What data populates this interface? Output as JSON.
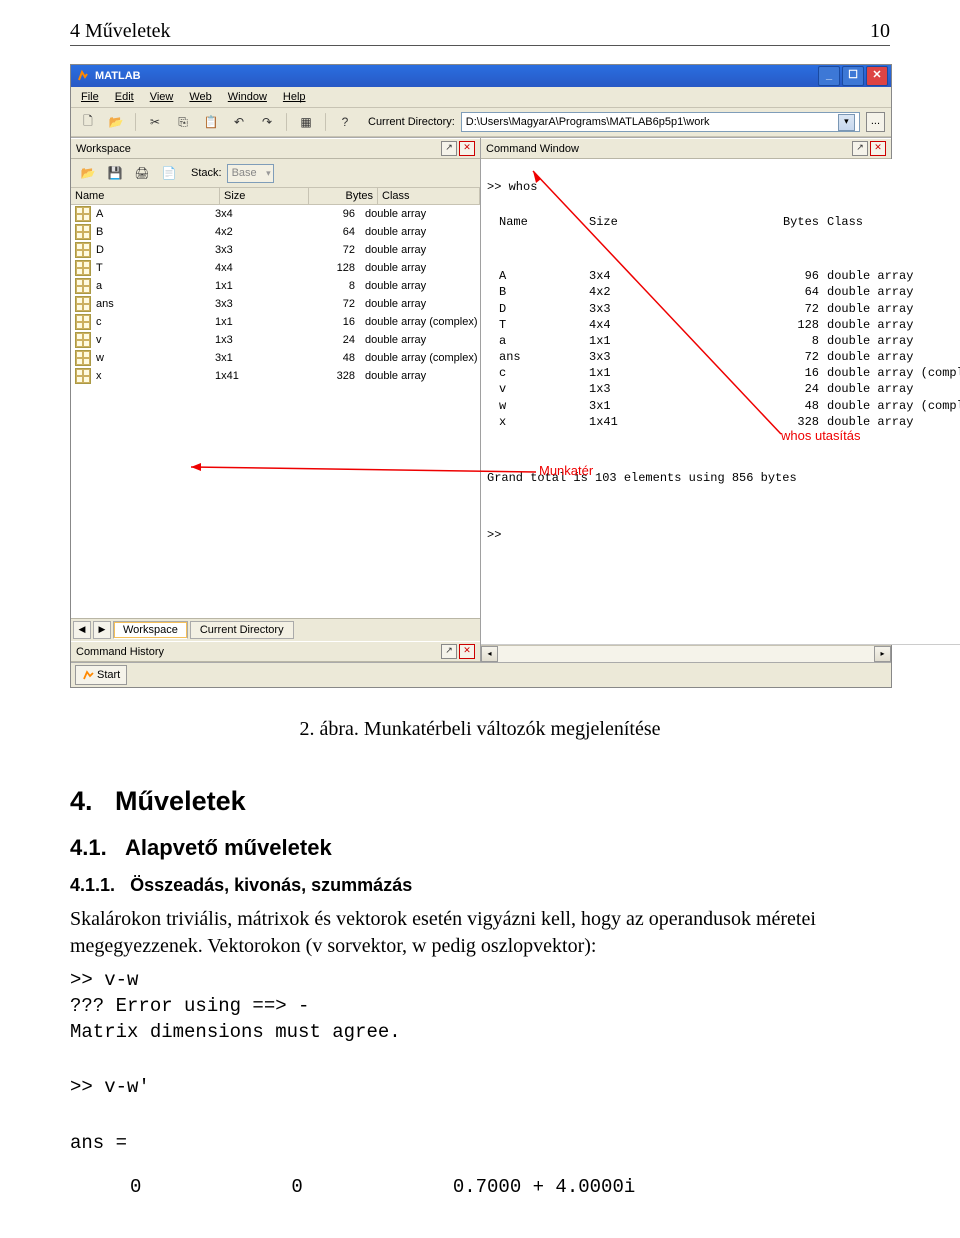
{
  "header": {
    "left": "4 Műveletek",
    "right": "10"
  },
  "app": {
    "title": "MATLAB",
    "menus": [
      "File",
      "Edit",
      "View",
      "Web",
      "Window",
      "Help"
    ],
    "dir_label": "Current Directory:",
    "dir_value": "D:\\Users\\MagyarA\\Programs\\MATLAB6p5p1\\work",
    "browse": "...",
    "toolbar_icons": {
      "new": "🗋",
      "open": "📂",
      "cut": "✂",
      "copy": "⎘",
      "paste": "📋",
      "undo": "↶",
      "redo": "↷",
      "simulink": "▦",
      "help": "?"
    }
  },
  "workspace": {
    "title": "Workspace",
    "stack_label": "Stack:",
    "stack_value": "Base",
    "toolbar_icons": {
      "open": "📂",
      "save": "💾",
      "print": "🖨",
      "new": "📄"
    },
    "headers": {
      "name": "Name",
      "size": "Size",
      "bytes": "Bytes",
      "class": "Class"
    },
    "rows": [
      {
        "name": "A",
        "size": "3x4",
        "bytes": "96",
        "class": "double array"
      },
      {
        "name": "B",
        "size": "4x2",
        "bytes": "64",
        "class": "double array"
      },
      {
        "name": "D",
        "size": "3x3",
        "bytes": "72",
        "class": "double array"
      },
      {
        "name": "T",
        "size": "4x4",
        "bytes": "128",
        "class": "double array"
      },
      {
        "name": "a",
        "size": "1x1",
        "bytes": "8",
        "class": "double array"
      },
      {
        "name": "ans",
        "size": "3x3",
        "bytes": "72",
        "class": "double array"
      },
      {
        "name": "c",
        "size": "1x1",
        "bytes": "16",
        "class": "double array (complex)"
      },
      {
        "name": "v",
        "size": "1x3",
        "bytes": "24",
        "class": "double array"
      },
      {
        "name": "w",
        "size": "3x1",
        "bytes": "48",
        "class": "double array (complex)"
      },
      {
        "name": "x",
        "size": "1x41",
        "bytes": "328",
        "class": "double array"
      }
    ],
    "tabs": {
      "active": "Workspace",
      "inactive": "Current Directory"
    }
  },
  "cmd_history": {
    "title": "Command History"
  },
  "cmd_window": {
    "title": "Command Window",
    "prompt_line": ">> whos",
    "headers": {
      "name": "Name",
      "size": "Size",
      "bytes": "Bytes",
      "class": "Class"
    },
    "rows": [
      {
        "name": "A",
        "size": "3x4",
        "bytes": "96",
        "class": "double array"
      },
      {
        "name": "B",
        "size": "4x2",
        "bytes": "64",
        "class": "double array"
      },
      {
        "name": "D",
        "size": "3x3",
        "bytes": "72",
        "class": "double array"
      },
      {
        "name": "T",
        "size": "4x4",
        "bytes": "128",
        "class": "double array"
      },
      {
        "name": "a",
        "size": "1x1",
        "bytes": "8",
        "class": "double array"
      },
      {
        "name": "ans",
        "size": "3x3",
        "bytes": "72",
        "class": "double array"
      },
      {
        "name": "c",
        "size": "1x1",
        "bytes": "16",
        "class": "double array (complex)"
      },
      {
        "name": "v",
        "size": "1x3",
        "bytes": "24",
        "class": "double array"
      },
      {
        "name": "w",
        "size": "3x1",
        "bytes": "48",
        "class": "double array (complex)"
      },
      {
        "name": "x",
        "size": "1x41",
        "bytes": "328",
        "class": "double array"
      }
    ],
    "total": "Grand total is 103 elements using 856 bytes",
    "prompt2": ">>"
  },
  "annotations": {
    "whos": "whos utasítás",
    "munkater": "Munkatér"
  },
  "start": "Start",
  "caption": "2. ábra. Munkatérbeli változók megjelenítése",
  "section": {
    "num": "4.",
    "title": "Műveletek"
  },
  "subsection": {
    "num": "4.1.",
    "title": "Alapvető műveletek"
  },
  "subsubsection": {
    "num": "4.1.1.",
    "title": "Összeadás, kivonás, szummázás"
  },
  "para": "Skalárokon triviális, mátrixok és vektorok esetén vigyázni kell, hogy az operandusok méretei megegyezzenek. Vektorokon (v sorvektor, w pedig oszlopvektor):",
  "code1": ">> v-w\n??? Error using ==> -\nMatrix dimensions must agree.",
  "code2": ">> v-w'",
  "code3": "ans =",
  "ans_row": [
    "0",
    "0",
    "0.7000 + 4.0000i"
  ]
}
